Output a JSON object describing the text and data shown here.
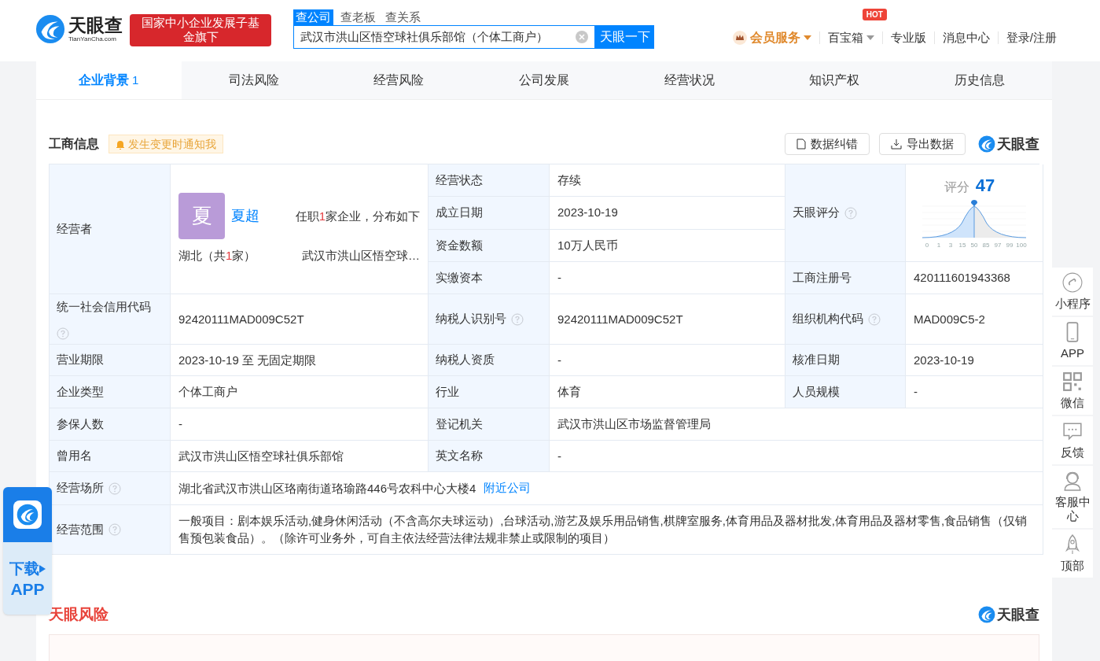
{
  "header": {
    "logo_text": "天眼查",
    "logo_sub": "TianYanCha.com",
    "badge": "国家中小企业发展子基金旗下",
    "search_tabs": [
      {
        "label": "查公司",
        "selected": true
      },
      {
        "label": "查老板",
        "selected": false
      },
      {
        "label": "查关系",
        "selected": false
      }
    ],
    "search_value": "武汉市洪山区悟空球社俱乐部馆（个体工商户）",
    "search_button": "天眼一下",
    "nav": [
      {
        "label": "会员服务",
        "kind": "vip"
      },
      {
        "label": "百宝箱",
        "kind": "dropdown",
        "badge": "HOT"
      },
      {
        "label": "专业版",
        "kind": "link"
      },
      {
        "label": "消息中心",
        "kind": "link"
      },
      {
        "label": "登录/注册",
        "kind": "link"
      }
    ]
  },
  "tabs": [
    {
      "label": "企业背景",
      "count": "1",
      "selected": true
    },
    {
      "label": "司法风险",
      "selected": false
    },
    {
      "label": "经营风险",
      "selected": false
    },
    {
      "label": "公司发展",
      "selected": false
    },
    {
      "label": "经营状况",
      "selected": false
    },
    {
      "label": "知识产权",
      "selected": false
    },
    {
      "label": "历史信息",
      "selected": false
    }
  ],
  "section": {
    "title": "工商信息",
    "notify": "发生变更时通知我",
    "actions": [
      {
        "label": "数据纠错",
        "kind": "doc"
      },
      {
        "label": "导出数据",
        "kind": "export"
      }
    ],
    "brand": "天眼查"
  },
  "operator": {
    "label": "经营者",
    "avatar": "夏",
    "name": "夏超",
    "roles": {
      "prefix": "任职",
      "count": "1",
      "suffix": "家企业，分布如下"
    },
    "region": {
      "prefix": "湖北（共",
      "count": "1",
      "suffix": "家）"
    },
    "company": "武汉市洪山区悟空球…"
  },
  "status_fields": [
    {
      "label": "经营状态",
      "value": "存续"
    },
    {
      "label": "成立日期",
      "value": "2023-10-19"
    },
    {
      "label": "资金数额",
      "value": "10万人民币"
    },
    {
      "label": "实缴资本",
      "value": "-"
    }
  ],
  "score": {
    "label": "天眼评分",
    "help": true,
    "title": "评分",
    "value": "47",
    "ticks": [
      "0",
      "1",
      "3",
      "15",
      "50",
      "85",
      "97",
      "99",
      "100"
    ]
  },
  "registration": {
    "label": "工商注册号",
    "value": "420111601943368"
  },
  "rows": [
    [
      {
        "label": "统一社会信用代码",
        "help": true,
        "value": "92420111MAD009C52T"
      },
      {
        "label": "纳税人识别号",
        "help": true,
        "value": "92420111MAD009C52T"
      },
      {
        "label": "组织机构代码",
        "help": true,
        "value": "MAD009C5-2"
      }
    ],
    [
      {
        "label": "营业期限",
        "help": false,
        "value": "2023-10-19 至 无固定期限"
      },
      {
        "label": "纳税人资质",
        "help": false,
        "value": "-"
      },
      {
        "label": "核准日期",
        "help": false,
        "value": "2023-10-19"
      }
    ],
    [
      {
        "label": "企业类型",
        "help": false,
        "value": "个体工商户"
      },
      {
        "label": "行业",
        "help": false,
        "value": "体育"
      },
      {
        "label": "人员规模",
        "help": false,
        "value": "-"
      }
    ],
    [
      {
        "label": "参保人数",
        "help": false,
        "value": "-"
      },
      {
        "label": "登记机关",
        "help": false,
        "value": "武汉市洪山区市场监督管理局"
      }
    ],
    [
      {
        "label": "曾用名",
        "help": false,
        "value": "武汉市洪山区悟空球社俱乐部馆"
      },
      {
        "label": "英文名称",
        "help": false,
        "value": "-"
      }
    ],
    [
      {
        "label": "经营场所",
        "help": true,
        "value": "湖北省武汉市洪山区珞南街道珞瑜路446号农科中心大楼4",
        "link": "附近公司"
      }
    ],
    [
      {
        "label": "经营范围",
        "help": true,
        "value": "一般项目：剧本娱乐活动,健身休闲活动（不含高尔夫球运动）,台球活动,游艺及娱乐用品销售,棋牌室服务,体育用品及器材批发,体育用品及器材零售,食品销售（仅销售预包装食品）。（除许可业务外，可自主依法经营法律法规非禁止或限制的项目）"
      }
    ]
  ],
  "risk": {
    "title": "天眼风险",
    "brand": "天眼查"
  },
  "side_tools": [
    {
      "label": "小程序",
      "kind": "mini"
    },
    {
      "label": "APP",
      "kind": "phone"
    },
    {
      "label": "微信",
      "kind": "qr"
    },
    {
      "label": "反馈",
      "kind": "chat"
    },
    {
      "label": "客服中心",
      "kind": "service"
    },
    {
      "label": "顶部",
      "kind": "rocket"
    }
  ],
  "download": {
    "label": "下载",
    "sub": "APP"
  }
}
